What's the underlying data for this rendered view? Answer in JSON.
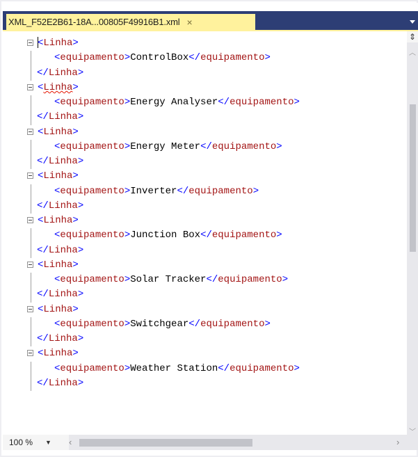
{
  "tab": {
    "title": "XML_F52E2B61-18A...00805F49916B1.xml",
    "close_glyph": "×"
  },
  "colors": {
    "tab_active": "#fff29d",
    "tab_strip": "#2d3e75",
    "xml_bracket": "#0000ff",
    "xml_tag": "#a31515",
    "xml_text": "#000000"
  },
  "xml": {
    "outer_tag": "Linha",
    "inner_tag": "equipamento",
    "items": [
      "ControlBox",
      "Energy Analyser",
      "Energy Meter",
      "Inverter",
      "Junction Box",
      "Solar Tracker",
      "Switchgear",
      "Weather Station"
    ]
  },
  "statusbar": {
    "zoom": "100 %"
  },
  "icons": {
    "fold": "collapse-minus-icon",
    "split": "split-view-icon",
    "tab_close": "close-icon",
    "dropdown": "chevron-down-icon"
  }
}
